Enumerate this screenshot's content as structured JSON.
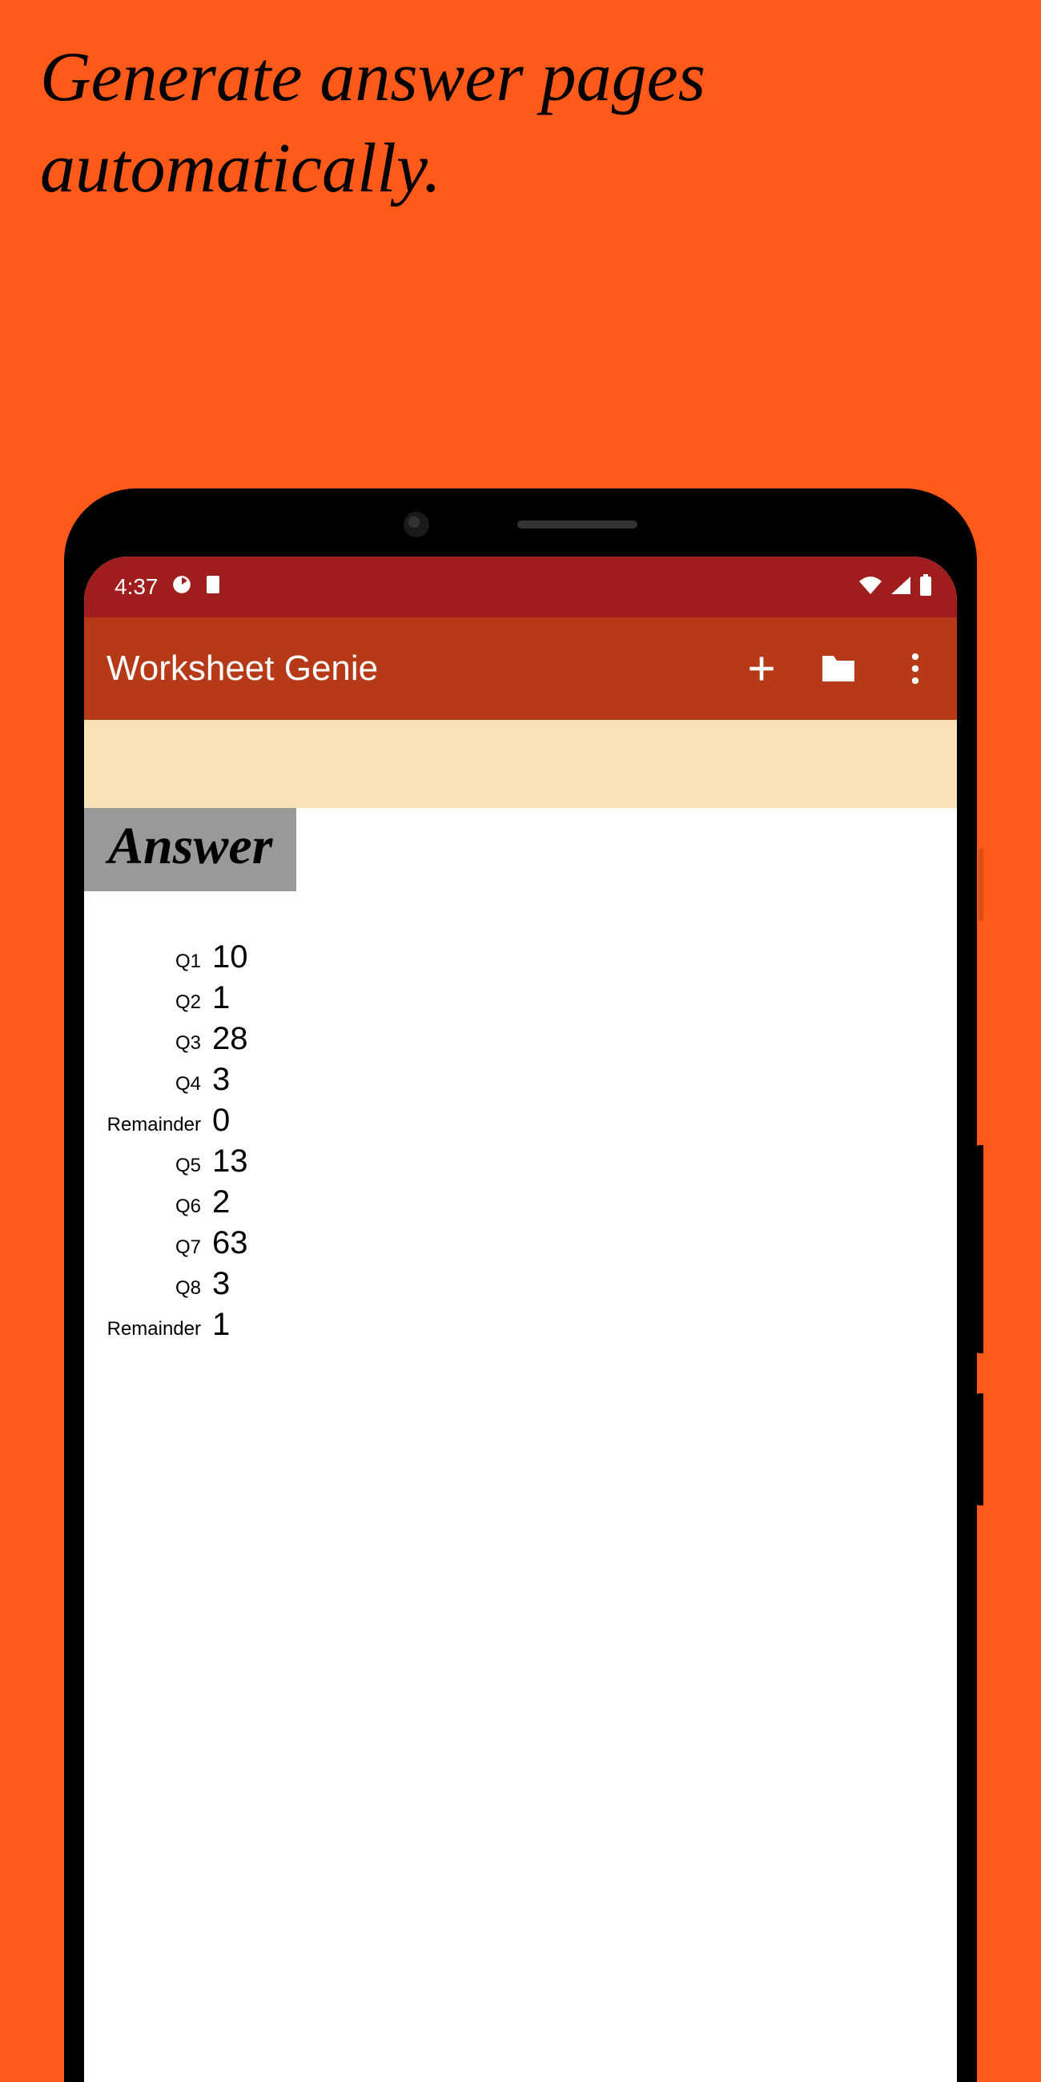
{
  "tagline": "Generate answer pages automatically.",
  "status_bar": {
    "time": "4:37"
  },
  "app_bar": {
    "title": "Worksheet Genie"
  },
  "answer_section": {
    "header": "Answer",
    "rows": [
      {
        "label": "Q1",
        "value": "10"
      },
      {
        "label": "Q2",
        "value": "1"
      },
      {
        "label": "Q3",
        "value": "28"
      },
      {
        "label": "Q4",
        "value": "3"
      },
      {
        "label": "Remainder",
        "value": "0"
      },
      {
        "label": "Q5",
        "value": "13"
      },
      {
        "label": "Q6",
        "value": "2"
      },
      {
        "label": "Q7",
        "value": "63"
      },
      {
        "label": "Q8",
        "value": "3"
      },
      {
        "label": "Remainder",
        "value": "1"
      }
    ]
  }
}
